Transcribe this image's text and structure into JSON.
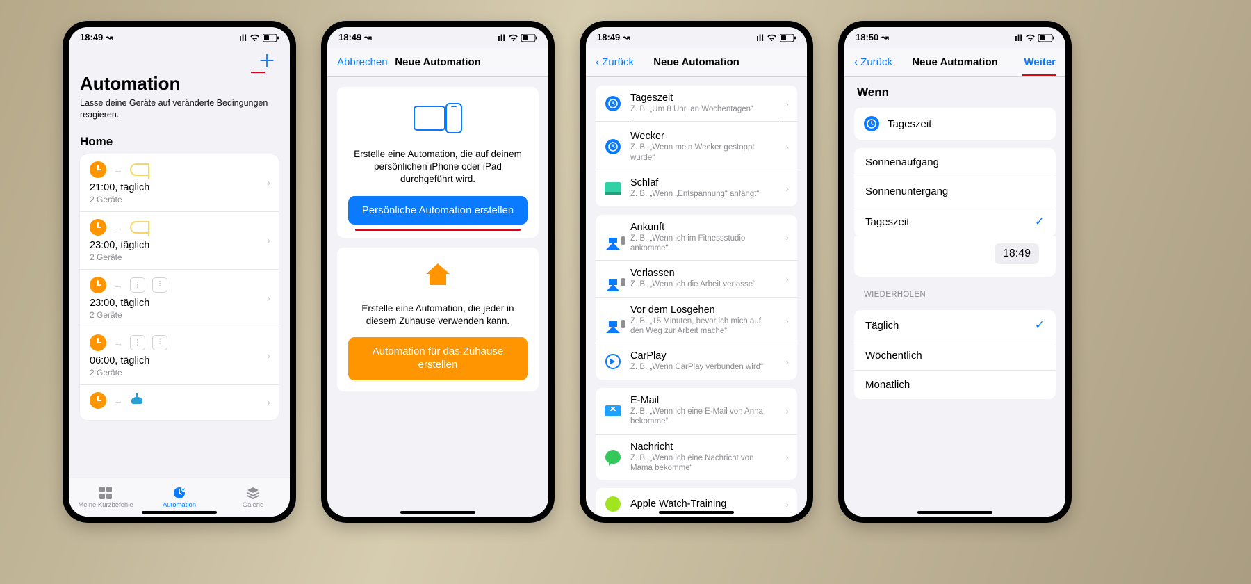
{
  "status": {
    "time1": "18:49 ↝",
    "time4": "18:50 ↝"
  },
  "s1": {
    "title": "Automation",
    "subtitle": "Lasse deine Geräte auf veränderte Bedingungen reagieren.",
    "section": "Home",
    "rows": [
      {
        "t": "21:00, täglich",
        "s": "2 Geräte",
        "kind": "scene"
      },
      {
        "t": "23:00, täglich",
        "s": "2 Geräte",
        "kind": "scene"
      },
      {
        "t": "23:00, täglich",
        "s": "2 Geräte",
        "kind": "plugs"
      },
      {
        "t": "06:00, täglich",
        "s": "2 Geräte",
        "kind": "plugs"
      },
      {
        "t": "",
        "s": "",
        "kind": "lamp"
      }
    ],
    "tabs": [
      "Meine Kurzbefehle",
      "Automation",
      "Galerie"
    ]
  },
  "s2": {
    "cancel": "Abbrechen",
    "title": "Neue Automation",
    "desc1": "Erstelle eine Automation, die auf deinem persönlichen iPhone oder iPad durchgeführt wird.",
    "btn1": "Persönliche Automation erstellen",
    "desc2": "Erstelle eine Automation, die jeder in diesem Zuhause verwenden kann.",
    "btn2": "Automation für das Zuhause erstellen"
  },
  "s3": {
    "back": "Zurück",
    "title": "Neue Automation",
    "groups": [
      [
        {
          "ic": "clock",
          "t": "Tageszeit",
          "s": "Z. B. „Um 8 Uhr, an Wochentagen“",
          "hl": true
        },
        {
          "ic": "clock",
          "t": "Wecker",
          "s": "Z. B. „Wenn mein Wecker gestoppt wurde“"
        },
        {
          "ic": "bed",
          "t": "Schlaf",
          "s": "Z. B. „Wenn „Entspannung“ anfängt“"
        }
      ],
      [
        {
          "ic": "house",
          "t": "Ankunft",
          "s": "Z. B. „Wenn ich im Fitnessstudio ankomme“"
        },
        {
          "ic": "house",
          "t": "Verlassen",
          "s": "Z. B. „Wenn ich die Arbeit verlasse“"
        },
        {
          "ic": "house",
          "t": "Vor dem Losgehen",
          "s": "Z. B. „15 Minuten, bevor ich mich auf den Weg zur Arbeit mache“"
        },
        {
          "ic": "carplay",
          "t": "CarPlay",
          "s": "Z. B. „Wenn CarPlay verbunden wird“"
        }
      ],
      [
        {
          "ic": "mail",
          "t": "E-Mail",
          "s": "Z. B. „Wenn ich eine E-Mail von Anna bekomme“"
        },
        {
          "ic": "msg",
          "t": "Nachricht",
          "s": "Z. B. „Wenn ich eine Nachricht von Mama bekomme“"
        }
      ],
      [
        {
          "ic": "watch",
          "t": "Apple Watch-Training",
          "s": ""
        }
      ]
    ]
  },
  "s4": {
    "back": "Zurück",
    "title": "Neue Automation",
    "next": "Weiter",
    "when": "Wenn",
    "trigger": "Tageszeit",
    "opts": [
      "Sonnenaufgang",
      "Sonnenuntergang",
      "Tageszeit"
    ],
    "sel": 2,
    "time": "18:49",
    "repeatLabel": "WIEDERHOLEN",
    "repeat": [
      "Täglich",
      "Wöchentlich",
      "Monatlich"
    ],
    "rsel": 0
  }
}
